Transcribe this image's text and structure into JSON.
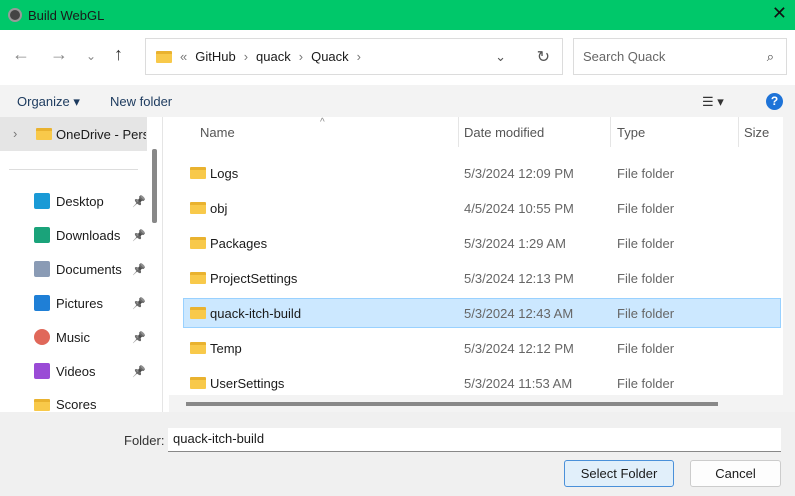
{
  "window": {
    "title": "Build WebGL"
  },
  "address": {
    "prefix": "«",
    "crumbs": [
      "GitHub",
      "quack",
      "Quack"
    ]
  },
  "search": {
    "placeholder": "Search Quack"
  },
  "toolbar": {
    "organize": "Organize ▾",
    "new_folder": "New folder",
    "help": "?"
  },
  "sidebar": {
    "onedrive": "OneDrive - Perso",
    "items": [
      {
        "label": "Desktop",
        "icon": "desktop-icon",
        "color": "#1a9ad6",
        "pinned": true
      },
      {
        "label": "Downloads",
        "icon": "download-icon",
        "color": "#1aa37a",
        "pinned": true
      },
      {
        "label": "Documents",
        "icon": "document-icon",
        "color": "#8a9bb5",
        "pinned": true
      },
      {
        "label": "Pictures",
        "icon": "pictures-icon",
        "color": "#1f7fd6",
        "pinned": true
      },
      {
        "label": "Music",
        "icon": "music-icon",
        "color": "#e0685a",
        "pinned": true
      },
      {
        "label": "Videos",
        "icon": "videos-icon",
        "color": "#9a4bd6",
        "pinned": true
      },
      {
        "label": "Scores",
        "icon": "folder-icon",
        "color": "#f8c94a",
        "pinned": false
      }
    ]
  },
  "columns": [
    "Name",
    "Date modified",
    "Type",
    "Size"
  ],
  "files": [
    {
      "name": "Logs",
      "date": "5/3/2024 12:09 PM",
      "type": "File folder"
    },
    {
      "name": "obj",
      "date": "4/5/2024 10:55 PM",
      "type": "File folder"
    },
    {
      "name": "Packages",
      "date": "5/3/2024 1:29 AM",
      "type": "File folder"
    },
    {
      "name": "ProjectSettings",
      "date": "5/3/2024 12:13 PM",
      "type": "File folder"
    },
    {
      "name": "quack-itch-build",
      "date": "5/3/2024 12:43 AM",
      "type": "File folder",
      "selected": true
    },
    {
      "name": "Temp",
      "date": "5/3/2024 12:12 PM",
      "type": "File folder"
    },
    {
      "name": "UserSettings",
      "date": "5/3/2024 11:53 AM",
      "type": "File folder"
    }
  ],
  "footer": {
    "folder_label": "Folder:",
    "folder_value": "quack-itch-build",
    "select": "Select Folder",
    "cancel": "Cancel"
  }
}
